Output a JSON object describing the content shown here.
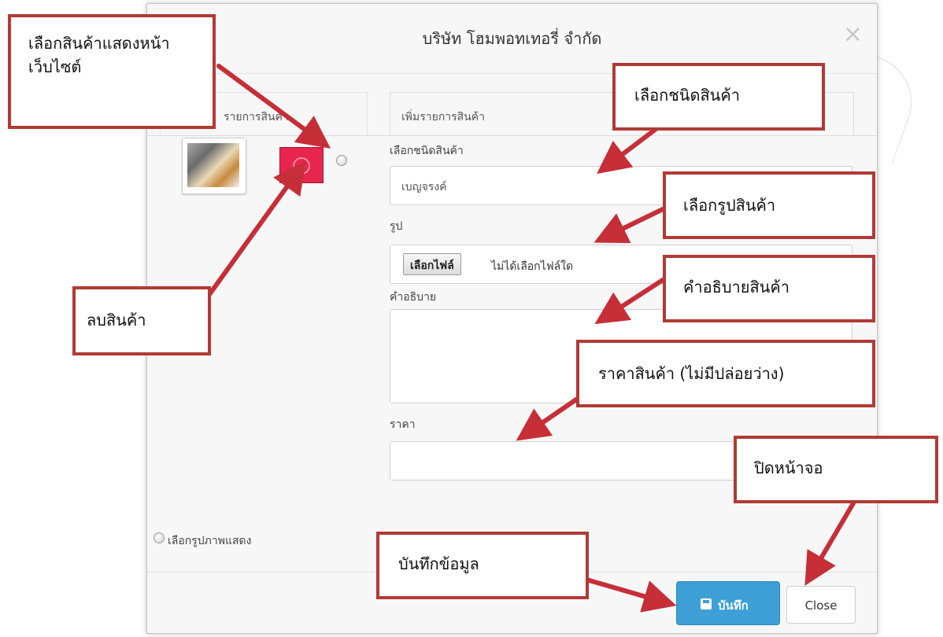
{
  "modal": {
    "title": "บริษัท โฮมพอทเทอรี่ จำกัด",
    "close_x": "×",
    "tab_list_label": "รายการสินค้า",
    "tab_add_label": "เพิ่มรายการสินค้า"
  },
  "form": {
    "product_type_label": "เลือกชนิดสินค้า",
    "product_type_value": "เบญจรงค์",
    "image_label": "รูป",
    "file_button_label": "เลือกไฟล์",
    "file_status": "ไม่ได้เลือกไฟล์ใด",
    "description_label": "คำอธิบาย",
    "price_label": "ราคา",
    "select_display_image_label": "เลือกรูปภาพแสดง"
  },
  "footer": {
    "save_label": "บันทึก",
    "close_label": "Close"
  },
  "annotations": {
    "select_for_website": "เลือกสินค้าแสดงหน้าเว็บไซต์",
    "delete_product": "ลบสินค้า",
    "select_product_type": "เลือกชนิดสินค้า",
    "select_product_image": "เลือกรูปสินค้า",
    "product_description": "คำอธิบายสินค้า",
    "product_price": "ราคาสินค้า (ไม่มีปล่อยว่าง)",
    "close_screen": "ปิดหน้าจอ",
    "save_data": "บันทึกข้อมูล"
  },
  "colors": {
    "callout_border": "#b13a35",
    "save_button": "#3d9fd6",
    "delete_button": "#e8264d"
  }
}
